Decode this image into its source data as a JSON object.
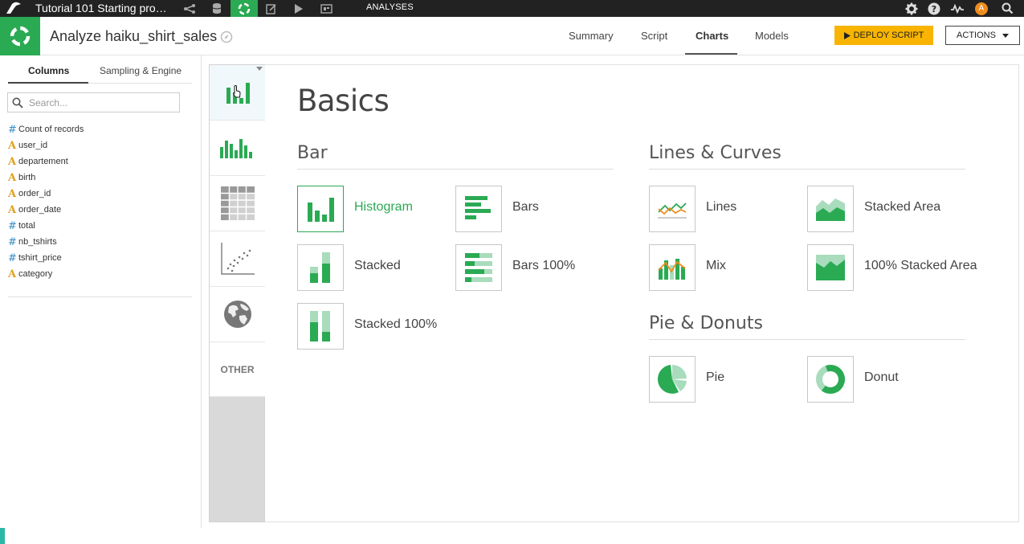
{
  "topbar": {
    "project_name": "Tutorial 101 Starting pro…",
    "section_label": "ANALYSES",
    "avatar_initial": "A",
    "icons": [
      "flow-icon",
      "datasets-icon",
      "analyses-icon",
      "notebook-icon",
      "jobs-icon",
      "dashboard-icon"
    ],
    "right_icons": [
      "settings-icon",
      "help-icon",
      "activity-icon",
      "avatar",
      "search-icon"
    ]
  },
  "header": {
    "title": "Analyze haiku_shirt_sales",
    "tabs": [
      {
        "label": "Summary"
      },
      {
        "label": "Script"
      },
      {
        "label": "Charts"
      },
      {
        "label": "Models"
      }
    ],
    "active_tab": "Charts",
    "deploy_label": "DEPLOY SCRIPT",
    "actions_label": "ACTIONS"
  },
  "left_panel": {
    "tabs": [
      {
        "label": "Columns"
      },
      {
        "label": "Sampling & Engine"
      }
    ],
    "search_placeholder": "Search...",
    "columns": [
      {
        "type": "#",
        "name": "Count of records"
      },
      {
        "type": "A",
        "name": "user_id"
      },
      {
        "type": "A",
        "name": "departement"
      },
      {
        "type": "A",
        "name": "birth"
      },
      {
        "type": "A",
        "name": "order_id"
      },
      {
        "type": "A",
        "name": "order_date"
      },
      {
        "type": "#",
        "name": "total"
      },
      {
        "type": "#",
        "name": "nb_tshirts"
      },
      {
        "type": "#",
        "name": "tshirt_price"
      },
      {
        "type": "A",
        "name": "category"
      }
    ]
  },
  "categories": {
    "items": [
      "basics-chart-icon",
      "histogram-bars-icon",
      "table-icon",
      "scatter-icon",
      "globe-icon"
    ],
    "other_label": "OTHER"
  },
  "main": {
    "heading": "Basics",
    "bar_section": {
      "title": "Bar",
      "items": [
        "Histogram",
        "Bars",
        "Stacked",
        "Bars 100%",
        "Stacked 100%"
      ]
    },
    "lines_section": {
      "title": "Lines & Curves",
      "items": [
        "Lines",
        "Stacked Area",
        "Mix",
        "100% Stacked Area"
      ]
    },
    "pie_section": {
      "title": "Pie & Donuts",
      "items": [
        "Pie",
        "Donut"
      ]
    },
    "selected": "Histogram"
  },
  "colors": {
    "accent_green": "#2aaa53",
    "light_green": "#a8dcbc",
    "deploy_yellow": "#f8b400",
    "topbar_bg": "#222222"
  }
}
